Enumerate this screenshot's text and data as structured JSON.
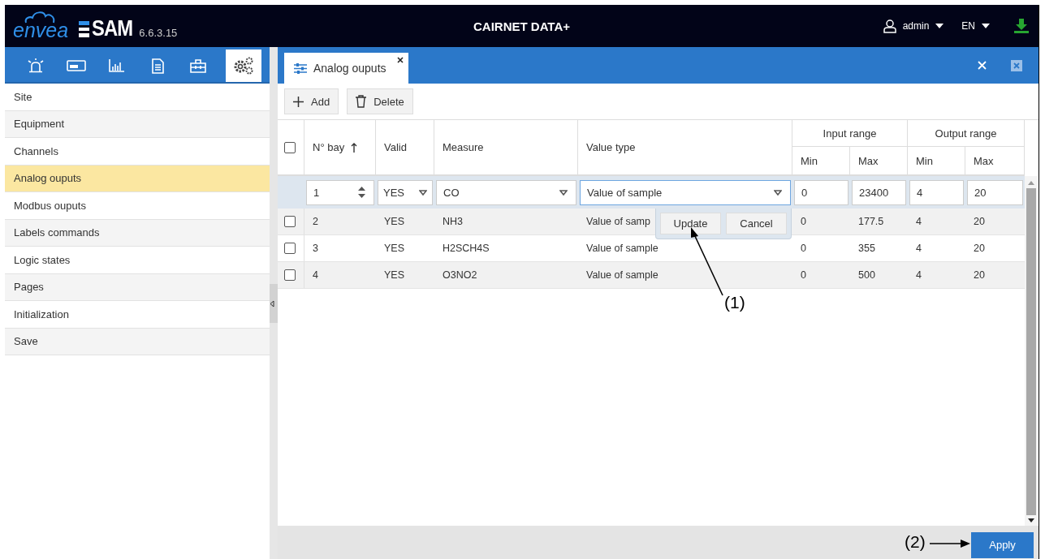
{
  "header": {
    "brand": "envea",
    "product": "SAM",
    "version": "6.6.3.15",
    "title": "CAIRNET DATA+",
    "user": "admin",
    "language": "EN"
  },
  "nav_icons": [
    {
      "kind": "alarm",
      "selected": false
    },
    {
      "kind": "device",
      "selected": false
    },
    {
      "kind": "chart",
      "selected": false
    },
    {
      "kind": "document",
      "selected": false
    },
    {
      "kind": "toolbox",
      "selected": false
    },
    {
      "kind": "settings",
      "selected": true
    }
  ],
  "sidebar": {
    "items": [
      {
        "label": "Site",
        "selected": false
      },
      {
        "label": "Equipment",
        "selected": false
      },
      {
        "label": "Channels",
        "selected": false
      },
      {
        "label": "Analog ouputs",
        "selected": true
      },
      {
        "label": "Modbus ouputs",
        "selected": false
      },
      {
        "label": "Labels commands",
        "selected": false
      },
      {
        "label": "Logic states",
        "selected": false
      },
      {
        "label": "Pages",
        "selected": false
      },
      {
        "label": "Initialization",
        "selected": false
      },
      {
        "label": "Save",
        "selected": false
      }
    ]
  },
  "tabs": [
    {
      "label": "Analog ouputs",
      "selected": true
    }
  ],
  "toolbar": {
    "buttons": [
      {
        "kind": "add",
        "label": "Add"
      },
      {
        "kind": "delete",
        "label": "Delete"
      }
    ]
  },
  "table": {
    "header_checked": false,
    "columns": {
      "bay": "N° bay",
      "bay_sorted": true,
      "valid": "Valid",
      "measure": "Measure",
      "value_type": "Value type",
      "input_range": "Input range",
      "output_range": "Output range",
      "input_min": "Min",
      "input_max": "Max",
      "output_min": "Min",
      "output_max": "Max"
    },
    "edit_row": {
      "bay": "1",
      "valid": "YES",
      "measure": "CO",
      "value_type": "Value of sample",
      "input_min": "0",
      "input_max": "23400",
      "output_min": "4",
      "output_max": "20"
    },
    "rows": [
      {
        "checked": false,
        "bay": "2",
        "valid": "YES",
        "measure": "NH3",
        "value_type": "Value of samp",
        "input_min": "0",
        "input_max": "177.5",
        "output_min": "4",
        "output_max": "20"
      },
      {
        "checked": false,
        "bay": "3",
        "valid": "YES",
        "measure": "H2SCH4S",
        "value_type": "Value of sample",
        "input_min": "0",
        "input_max": "355",
        "output_min": "4",
        "output_max": "20"
      },
      {
        "checked": false,
        "bay": "4",
        "valid": "YES",
        "measure": "O3NO2",
        "value_type": "Value of sample",
        "input_min": "0",
        "input_max": "500",
        "output_min": "4",
        "output_max": "20"
      }
    ]
  },
  "popup": {
    "buttons": [
      "Update",
      "Cancel"
    ]
  },
  "footer": {
    "apply": "Apply"
  },
  "annotations": [
    {
      "label": "(1)"
    },
    {
      "label": "(2)"
    }
  ]
}
